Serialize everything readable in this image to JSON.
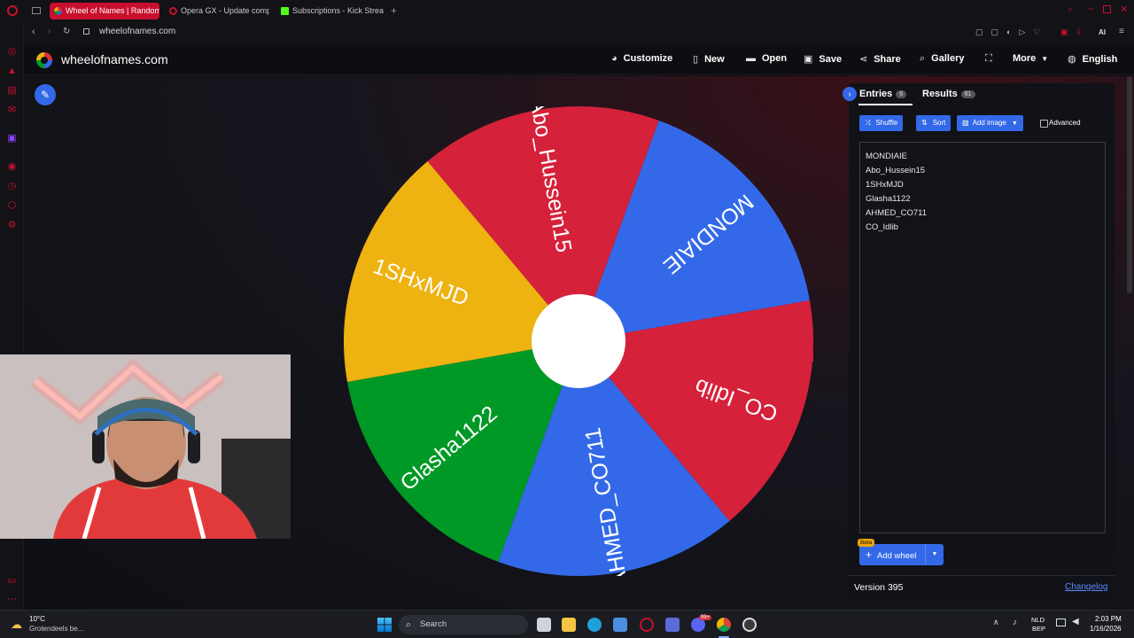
{
  "browser": {
    "tabs": [
      {
        "title": "Wheel of Names | Random",
        "active": true
      },
      {
        "title": "Opera GX - Update comp",
        "active": false
      },
      {
        "title": "Subscriptions - Kick Strea",
        "active": false
      }
    ],
    "url": "wheelofnames.com",
    "ai_label": "AI"
  },
  "site": {
    "name": "wheelofnames.com",
    "nav": {
      "customize": "Customize",
      "new": "New",
      "open": "Open",
      "save": "Save",
      "share": "Share",
      "gallery": "Gallery",
      "more": "More",
      "language": "English"
    }
  },
  "wheel": {
    "segments": [
      {
        "label": "MONDIAIE",
        "color": "#3369e8"
      },
      {
        "label": "CO_Idlib",
        "color": "#d5213a"
      },
      {
        "label": "AHMED_CO711",
        "color": "#3369e8"
      },
      {
        "label": "Glasha1122",
        "color": "#009925"
      },
      {
        "label": "1SHxMJD",
        "color": "#eeb211"
      },
      {
        "label": "Abo_Hussein15",
        "color": "#d5213a"
      }
    ]
  },
  "sidebar": {
    "entries_tab": "Entries",
    "entries_count": "6",
    "results_tab": "Results",
    "results_count": "61",
    "shuffle": "Shuffle",
    "sort": "Sort",
    "add_image": "Add image",
    "advanced": "Advanced",
    "entries": [
      "MONDIAIE",
      "Abo_Hussein15",
      "1SHxMJD",
      "Glasha1122",
      "AHMED_CO711",
      "CO_Idlib"
    ],
    "beta": "Beta",
    "add_wheel": "Add wheel",
    "version": "Version 395",
    "changelog": "Changelog"
  },
  "taskbar": {
    "weather_temp": "10°C",
    "weather_desc": "Grotendeels be...",
    "search": "Search",
    "lang1": "NLD",
    "lang2": "BEP",
    "time": "2:03 PM",
    "date": "1/16/2026",
    "badge": "99+"
  },
  "colors": {
    "accent": "#3369e8",
    "opera_red": "#c8102e",
    "pointer": "#d5213a"
  }
}
